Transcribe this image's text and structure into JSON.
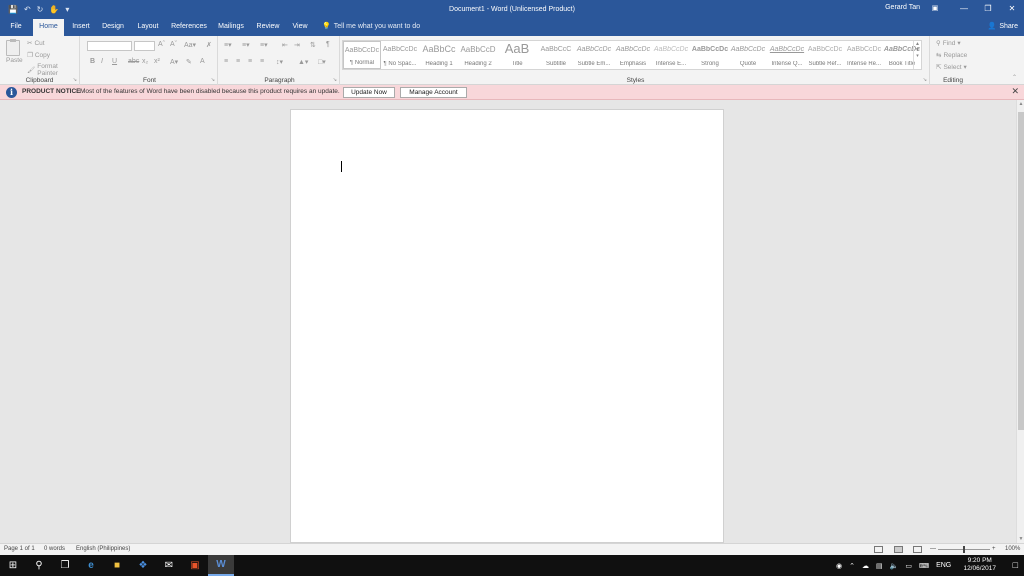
{
  "titlebar": {
    "document_title": "Document1 - Word (Unlicensed Product)",
    "user": "Gerard Tan",
    "quick_access": [
      "save-icon",
      "undo-icon",
      "redo-icon",
      "touch-mode-icon",
      "customize-icon"
    ]
  },
  "tabs": [
    {
      "label": "File"
    },
    {
      "label": "Home"
    },
    {
      "label": "Insert"
    },
    {
      "label": "Design"
    },
    {
      "label": "Layout"
    },
    {
      "label": "References"
    },
    {
      "label": "Mailings"
    },
    {
      "label": "Review"
    },
    {
      "label": "View"
    }
  ],
  "tell_me": "Tell me what you want to do",
  "share_label": "Share",
  "clipboard": {
    "label": "Clipboard",
    "paste": "Paste",
    "cut": "Cut",
    "copy": "Copy",
    "format_painter": "Format Painter"
  },
  "font_group": {
    "label": "Font"
  },
  "paragraph_group": {
    "label": "Paragraph"
  },
  "styles_group": {
    "label": "Styles",
    "items": [
      {
        "sample": "AaBbCcDc",
        "name": "¶ Normal"
      },
      {
        "sample": "AaBbCcDc",
        "name": "¶ No Spac..."
      },
      {
        "sample": "AaBbCc",
        "name": "Heading 1"
      },
      {
        "sample": "AaBbCcD",
        "name": "Heading 2"
      },
      {
        "sample": "AaB",
        "name": "Title"
      },
      {
        "sample": "AaBbCcC",
        "name": "Subtitle"
      },
      {
        "sample": "AaBbCcDc",
        "name": "Subtle Em..."
      },
      {
        "sample": "AaBbCcDc",
        "name": "Emphasis"
      },
      {
        "sample": "AaBbCcDc",
        "name": "Intense E..."
      },
      {
        "sample": "AaBbCcDc",
        "name": "Strong"
      },
      {
        "sample": "AaBbCcDc",
        "name": "Quote"
      },
      {
        "sample": "AaBbCcDc",
        "name": "Intense Q..."
      },
      {
        "sample": "AaBbCcDc",
        "name": "Subtle Ref..."
      },
      {
        "sample": "AaBbCcDc",
        "name": "Intense Re..."
      },
      {
        "sample": "AaBbCcDc",
        "name": "Book Title"
      }
    ]
  },
  "editing": {
    "label": "Editing",
    "find": "Find",
    "replace": "Replace",
    "select": "Select"
  },
  "notice": {
    "title": "PRODUCT NOTICE",
    "message": "Most of the features of Word have been disabled because this product requires an update.",
    "update_now": "Update Now",
    "manage_account": "Manage Account"
  },
  "status": {
    "page": "Page 1 of 1",
    "words": "0 words",
    "language": "English (Philippines)",
    "zoom": "100%"
  },
  "taskbar": {
    "lang": "ENG",
    "time": "9:20 PM",
    "date": "12/06/2017"
  },
  "colors": {
    "word_blue": "#2b579a",
    "notice_bg": "#f8d7da"
  }
}
